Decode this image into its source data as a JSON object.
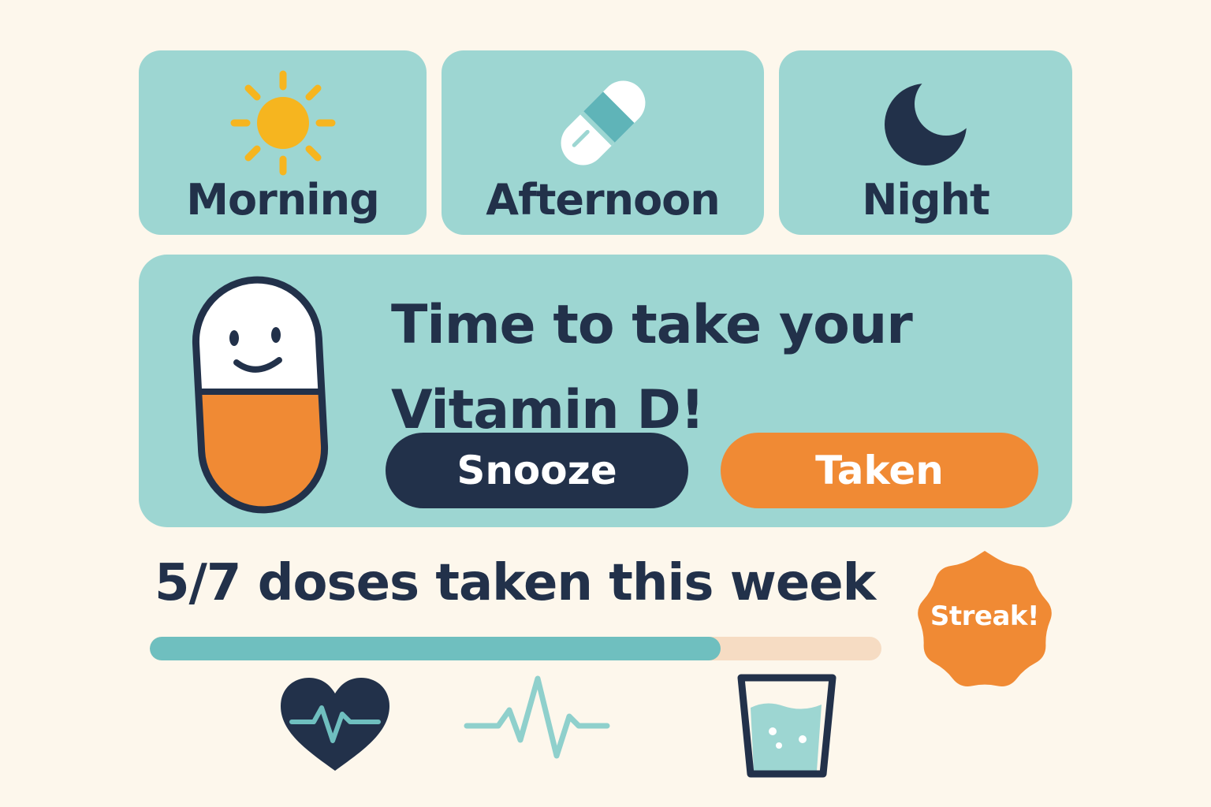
{
  "time_tabs": [
    {
      "label": "Morning",
      "icon": "sun-icon"
    },
    {
      "label": "Afternoon",
      "icon": "pill-capsule-icon"
    },
    {
      "label": "Night",
      "icon": "moon-icon"
    }
  ],
  "reminder": {
    "mascot": "smiling-pill-mascot-icon",
    "message_line1": "Time to take your",
    "message_line2": "Vitamin D!",
    "snooze_label": "Snooze",
    "taken_label": "Taken"
  },
  "progress": {
    "label": "5/7 doses taken this week",
    "taken": 5,
    "total": 7,
    "fraction": 0.78
  },
  "badge": {
    "label": "Streak!",
    "icon": "burst-badge-icon"
  },
  "bottom_icons": [
    "heart-pulse-icon",
    "pulse-line-icon",
    "water-glass-icon"
  ],
  "colors": {
    "background": "#fdf7ec",
    "panel": "#9dd6d2",
    "navy": "#22314a",
    "orange": "#f08a34",
    "teal": "#6fbfbf",
    "track": "#f6dcc3",
    "sun": "#f6b51f"
  }
}
